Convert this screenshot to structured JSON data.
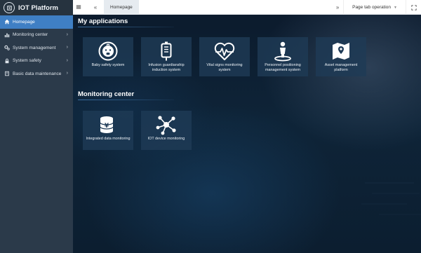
{
  "app": {
    "title": "IOT Platform"
  },
  "sidebar": {
    "items": [
      {
        "label": "Homepage",
        "icon": "home-icon",
        "active": true
      },
      {
        "label": "Monitoring center",
        "icon": "bar-chart-icon"
      },
      {
        "label": "System management",
        "icon": "gears-icon"
      },
      {
        "label": "System safety",
        "icon": "lock-icon"
      },
      {
        "label": "Basic data maintenance",
        "icon": "book-icon"
      }
    ]
  },
  "topbar": {
    "tab_home": "Homepage",
    "page_operation": "Page tab operation"
  },
  "my_applications": {
    "title": "My applications",
    "cards": [
      {
        "label": "Baby safety system",
        "icon": "baby-icon"
      },
      {
        "label": "Infusion guardianship induction system",
        "icon": "infusion-bag-icon"
      },
      {
        "label": "Vital signs monitoring system",
        "icon": "heartbeat-icon"
      },
      {
        "label": "Personnel positioning management system",
        "icon": "person-location-icon"
      },
      {
        "label": "Asset management platform",
        "icon": "map-pin-icon"
      }
    ]
  },
  "monitoring_center": {
    "title": "Monitoring center",
    "cards": [
      {
        "label": "Integrated data monitoring",
        "icon": "yen-coins-icon"
      },
      {
        "label": "IOT device monitoring",
        "icon": "network-nodes-icon"
      }
    ]
  },
  "colors": {
    "sidebar": "#2b3a4a",
    "active": "#3f7fc4",
    "card": "#1e3a56",
    "background": "#0c1b2d"
  }
}
